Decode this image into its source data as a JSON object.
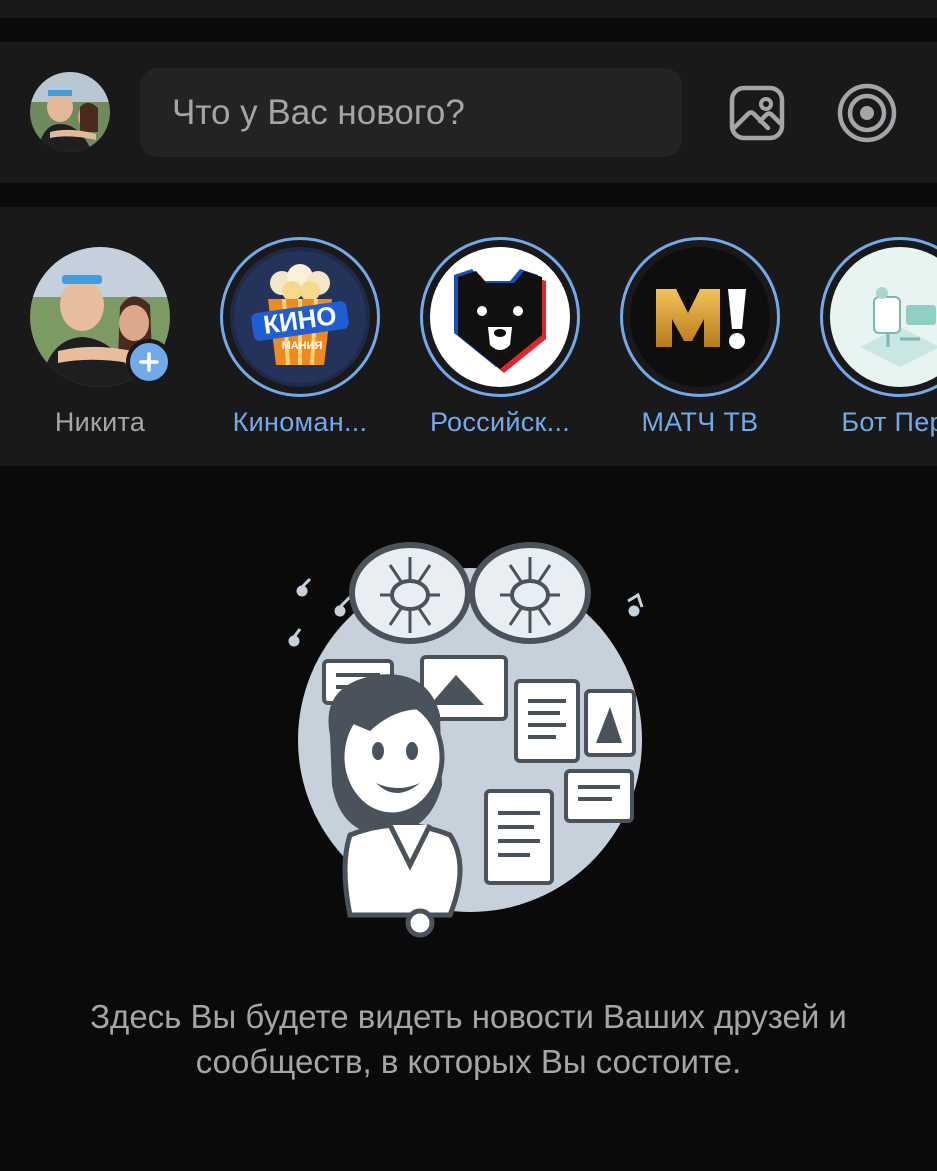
{
  "composer": {
    "placeholder": "Что у Вас нового?",
    "avatar_icon": "user-avatar",
    "photo_icon": "photo-icon",
    "story_icon": "story-camera-icon"
  },
  "stories": [
    {
      "name": "Никита",
      "type": "own",
      "has_add_badge": true,
      "icon": "user-avatar"
    },
    {
      "name": "Киноман...",
      "type": "community",
      "logo_text_top": "КИНО",
      "logo_text_bottom": "МАНИЯ",
      "icon": "kinomania-logo"
    },
    {
      "name": "Российск...",
      "type": "community",
      "icon": "bear-logo"
    },
    {
      "name": "МАТЧ ТВ",
      "type": "community",
      "logo_text": "М!",
      "icon": "match-tv-logo"
    },
    {
      "name": "Бот Перс",
      "type": "community",
      "icon": "bot-logo"
    }
  ],
  "empty_state": {
    "illustration": "girl-with-news-illustration",
    "message": "Здесь Вы будете видеть новости Ваших друзей и сообществ, в которых Вы состоите."
  },
  "colors": {
    "background": "#0a0a0a",
    "panel": "#19191a",
    "accent": "#71aaeb",
    "text_secondary": "#a3a5a8"
  }
}
